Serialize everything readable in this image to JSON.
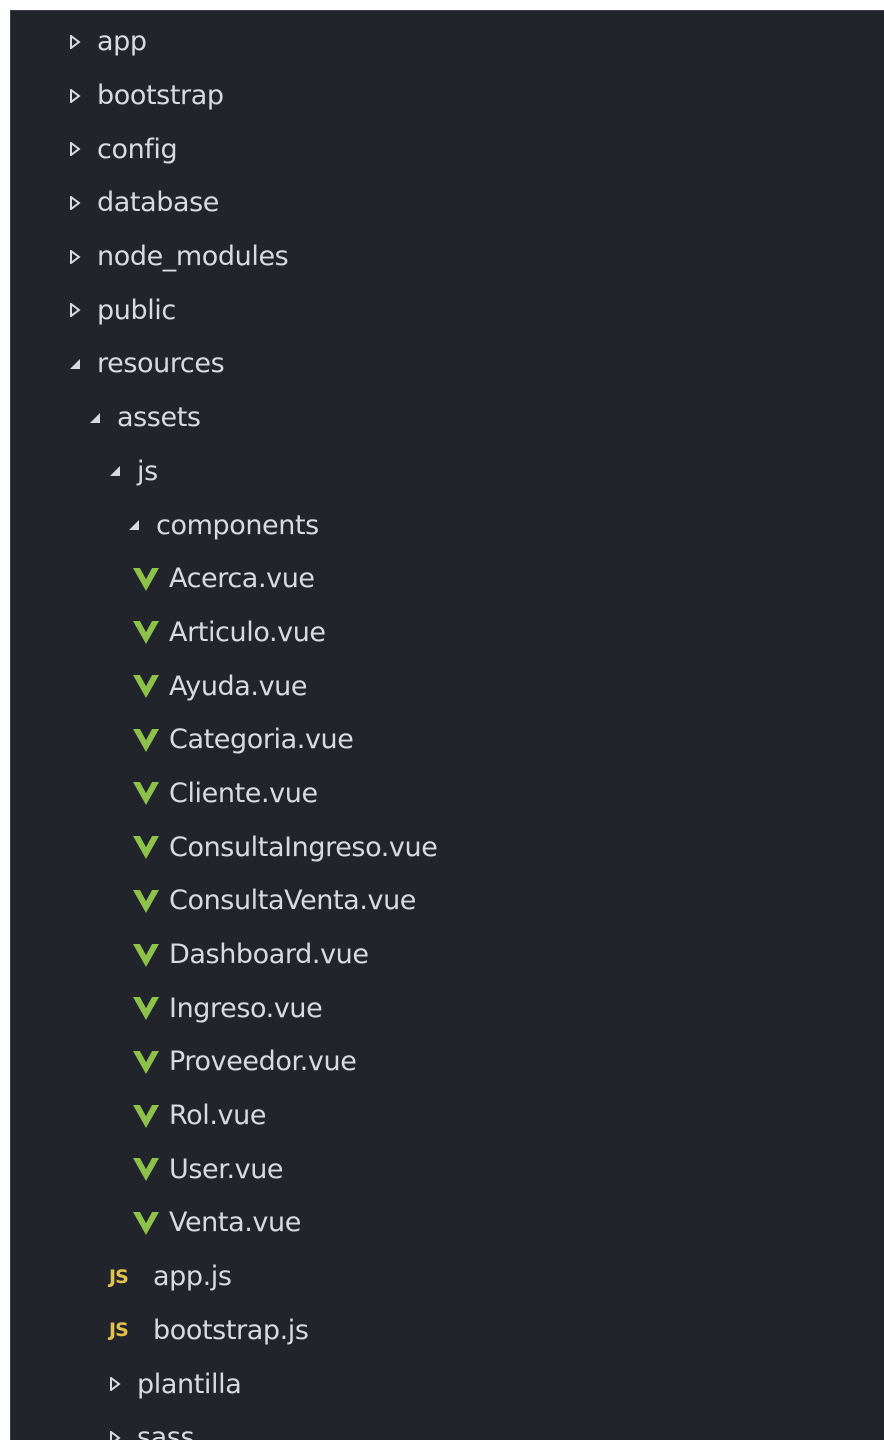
{
  "explorer": {
    "root_folders": [
      {
        "label": "app",
        "state": "collapsed"
      },
      {
        "label": "bootstrap",
        "state": "collapsed"
      },
      {
        "label": "config",
        "state": "collapsed"
      },
      {
        "label": "database",
        "state": "collapsed"
      },
      {
        "label": "node_modules",
        "state": "collapsed"
      },
      {
        "label": "public",
        "state": "collapsed"
      },
      {
        "label": "resources",
        "state": "expanded"
      }
    ],
    "assets": {
      "label": "assets",
      "state": "expanded"
    },
    "js": {
      "label": "js",
      "state": "expanded"
    },
    "components": {
      "label": "components",
      "state": "expanded"
    },
    "vue_files": [
      "Acerca.vue",
      "Articulo.vue",
      "Ayuda.vue",
      "Categoria.vue",
      "Cliente.vue",
      "ConsultaIngreso.vue",
      "ConsultaVenta.vue",
      "Dashboard.vue",
      "Ingreso.vue",
      "Proveedor.vue",
      "Rol.vue",
      "User.vue",
      "Venta.vue"
    ],
    "js_files": [
      {
        "label": "app.js",
        "badge": "JS"
      },
      {
        "label": "bootstrap.js",
        "badge": "JS"
      }
    ],
    "asset_folders": [
      {
        "label": "plantilla",
        "state": "collapsed"
      },
      {
        "label": "sass",
        "state": "collapsed"
      }
    ]
  },
  "colors": {
    "background": "#21252b",
    "text": "#d7dae0",
    "vue_icon": "#8dc149",
    "js_badge": "#e5c04c"
  }
}
